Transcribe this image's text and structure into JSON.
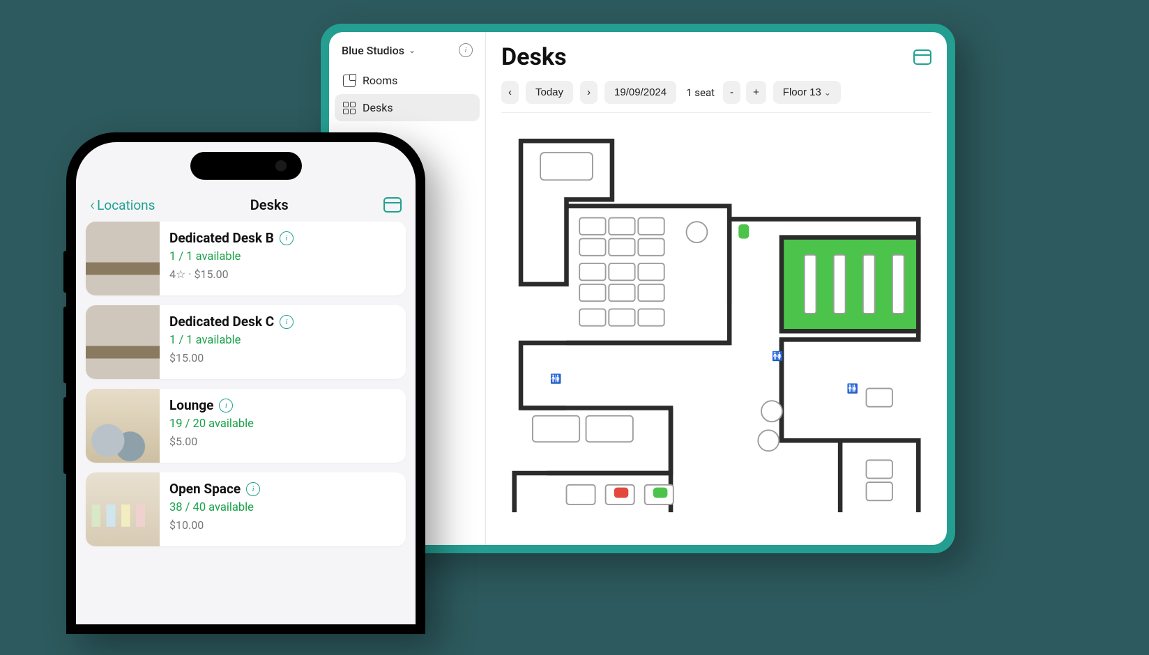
{
  "tablet": {
    "workspace": "Blue Studios",
    "nav": {
      "rooms": "Rooms",
      "desks": "Desks"
    },
    "page_title": "Desks",
    "toolbar": {
      "today": "Today",
      "date": "19/09/2024",
      "seat_label": "1 seat",
      "minus": "-",
      "plus": "+",
      "floor": "Floor 13"
    },
    "floorplan": {
      "status_colors": {
        "available": "#4cc34a",
        "occupied": "#e2483d"
      },
      "highlighted_room": "meeting-room-east"
    }
  },
  "phone": {
    "back_label": "Locations",
    "title": "Desks",
    "items": [
      {
        "name": "Dedicated Desk B",
        "availability": "1 / 1 available",
        "meta": "4☆ · $15.00",
        "thumb": "desk"
      },
      {
        "name": "Dedicated Desk C",
        "availability": "1 / 1 available",
        "meta": "$15.00",
        "thumb": "desk"
      },
      {
        "name": "Lounge",
        "availability": "19 / 20 available",
        "meta": "$5.00",
        "thumb": "lounge"
      },
      {
        "name": "Open Space",
        "availability": "38 / 40 available",
        "meta": "$10.00",
        "thumb": "open"
      }
    ]
  }
}
